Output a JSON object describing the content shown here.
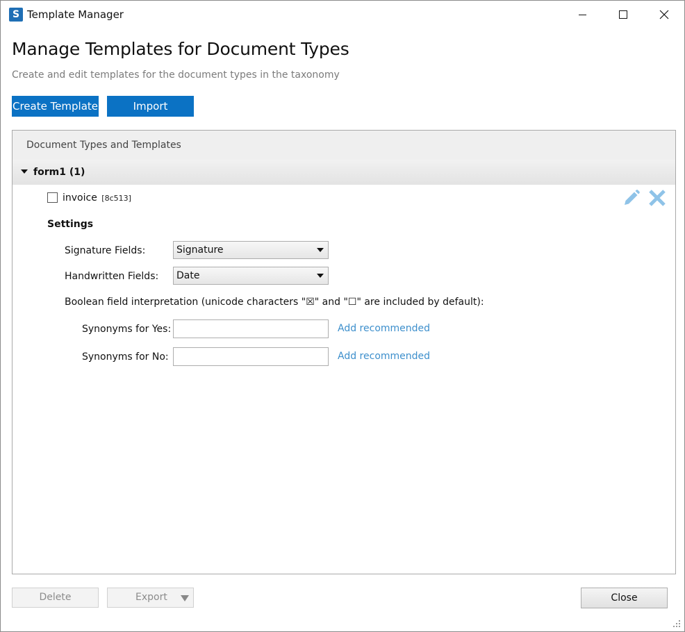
{
  "window": {
    "title": "Template Manager",
    "app_icon_glyph": "S",
    "controls": [
      "minimize-icon",
      "maximize-icon",
      "close-icon"
    ]
  },
  "header": {
    "title": "Manage Templates for Document Types",
    "subtitle": "Create and edit templates for the document types in the taxonomy"
  },
  "actions": {
    "create_label": "Create Template",
    "import_label": "Import"
  },
  "panel": {
    "header_label": "Document Types and Templates",
    "group": {
      "label": "form1 (1)",
      "expanded": true
    },
    "template": {
      "name": "invoice",
      "id": "[8c513]",
      "checked": false
    },
    "settings": {
      "title": "Settings",
      "signature_label": "Signature Fields:",
      "signature_value": "Signature",
      "handwritten_label": "Handwritten Fields:",
      "handwritten_value": "Date",
      "boolean_label": "Boolean field interpretation (unicode characters \"☒\" and \"☐\" are included by default):",
      "yes_label": "Synonyms for Yes:",
      "yes_value": "",
      "no_label": "Synonyms for No:",
      "no_value": "",
      "add_recommended": "Add recommended"
    }
  },
  "footer": {
    "delete_label": "Delete",
    "export_label": "Export",
    "close_label": "Close"
  },
  "colors": {
    "accent": "#0b72c4",
    "link": "#3d8fcc",
    "icon_light": "#8fc3e8"
  }
}
